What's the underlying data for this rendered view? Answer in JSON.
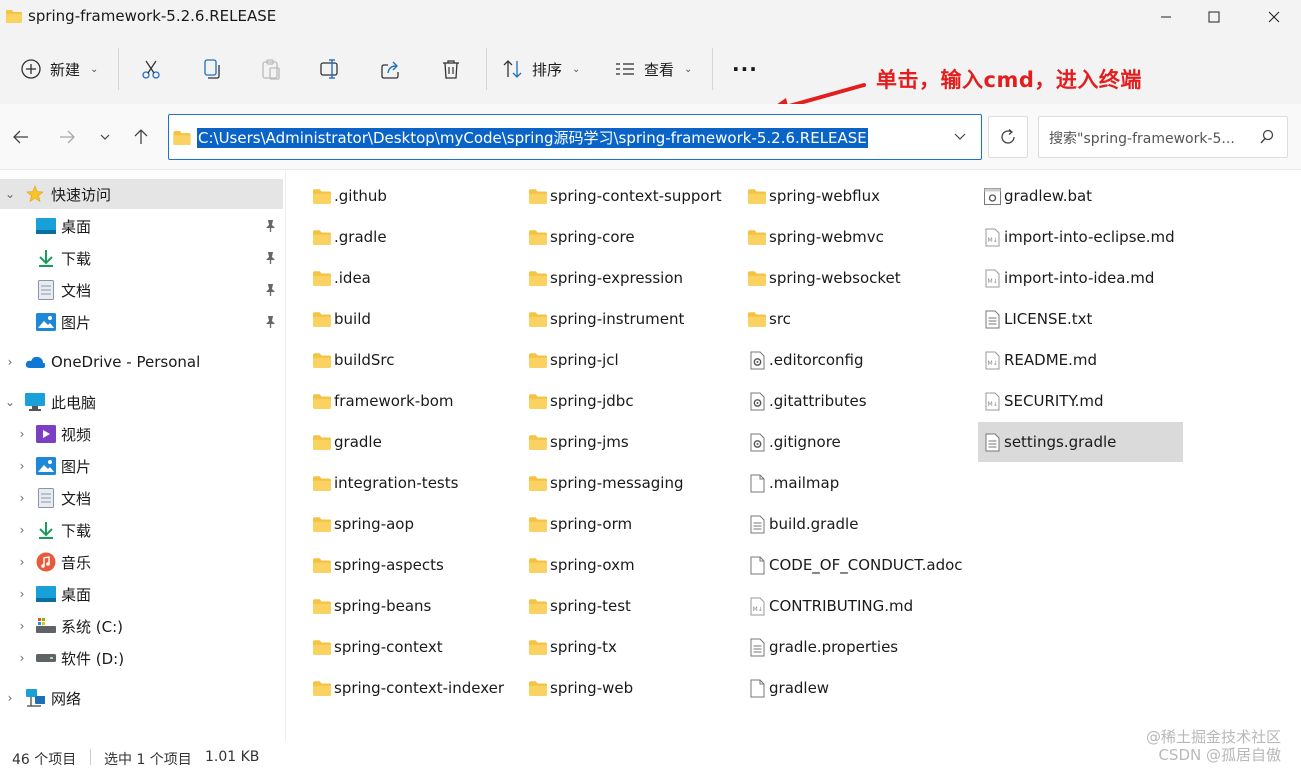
{
  "window": {
    "title": "spring-framework-5.2.6.RELEASE"
  },
  "toolbar": {
    "new_label": "新建",
    "sort_label": "排序",
    "view_label": "查看",
    "more_label": "···"
  },
  "annotation": {
    "text": "单击，输入cmd，进入终端"
  },
  "nav": {
    "path": "C:\\Users\\Administrator\\Desktop\\myCode\\spring源码学习\\spring-framework-5.2.6.RELEASE",
    "search_placeholder": "搜索\"spring-framework-5..."
  },
  "sidebar": {
    "quick_access": "快速访问",
    "quick_items": [
      "桌面",
      "下载",
      "文档",
      "图片"
    ],
    "onedrive": "OneDrive - Personal",
    "this_pc": "此电脑",
    "pc_items": [
      "视频",
      "图片",
      "文档",
      "下载",
      "音乐",
      "桌面",
      "系统 (C:)",
      "软件 (D:)"
    ],
    "network": "网络"
  },
  "files": {
    "col1": [
      ".github",
      ".gradle",
      ".idea",
      "build",
      "buildSrc",
      "framework-bom",
      "gradle",
      "integration-tests",
      "spring-aop",
      "spring-aspects",
      "spring-beans",
      "spring-context",
      "spring-context-indexer"
    ],
    "col2": [
      "spring-context-support",
      "spring-core",
      "spring-expression",
      "spring-instrument",
      "spring-jcl",
      "spring-jdbc",
      "spring-jms",
      "spring-messaging",
      "spring-orm",
      "spring-oxm",
      "spring-test",
      "spring-tx",
      "spring-web"
    ],
    "col3": [
      "spring-webflux",
      "spring-webmvc",
      "spring-websocket",
      "src",
      ".editorconfig",
      ".gitattributes",
      ".gitignore",
      ".mailmap",
      "build.gradle",
      "CODE_OF_CONDUCT.adoc",
      "CONTRIBUTING.md",
      "gradle.properties",
      "gradlew"
    ],
    "col4": [
      "gradlew.bat",
      "import-into-eclipse.md",
      "import-into-idea.md",
      "LICENSE.txt",
      "README.md",
      "SECURITY.md",
      "settings.gradle"
    ]
  },
  "status": {
    "count": "46 个项目",
    "selected": "选中 1 个项目",
    "size": "1.01 KB"
  },
  "watermark": {
    "line1": "@稀土掘金技术社区",
    "line2": "CSDN @孤居自傲"
  },
  "colors": {
    "folder": "#f5c344",
    "accent": "#0a64c8",
    "annotation": "#e21e1e"
  }
}
